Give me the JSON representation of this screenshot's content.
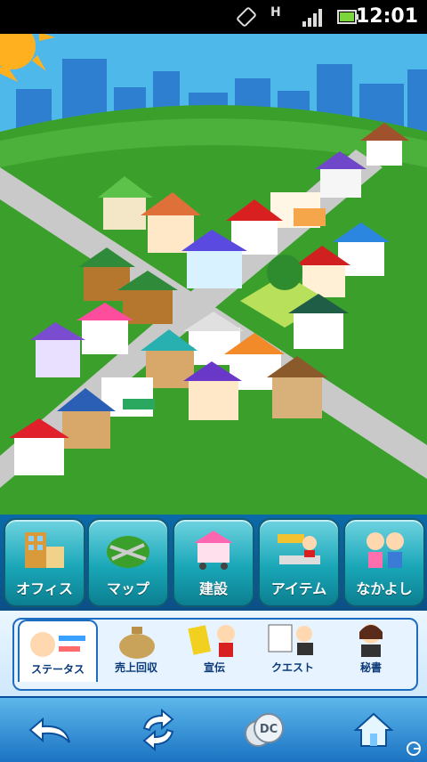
{
  "status": {
    "time": "12:01",
    "network": "H"
  },
  "main_nav": [
    {
      "label": "オフィス",
      "name": "office"
    },
    {
      "label": "マップ",
      "name": "map"
    },
    {
      "label": "建設",
      "name": "build"
    },
    {
      "label": "アイテム",
      "name": "items"
    },
    {
      "label": "なかよし",
      "name": "friends"
    }
  ],
  "sub_tabs": [
    {
      "label": "ステータス",
      "name": "status",
      "active": true
    },
    {
      "label": "売上回収",
      "name": "collect-sales"
    },
    {
      "label": "宣伝",
      "name": "advertise"
    },
    {
      "label": "クエスト",
      "name": "quest"
    },
    {
      "label": "秘書",
      "name": "secretary"
    }
  ],
  "bottom": {
    "dc_label": "DC"
  },
  "colors": {
    "sky": "#49b3ea",
    "grass": "#3aa02b",
    "road": "#c9c9c9"
  }
}
